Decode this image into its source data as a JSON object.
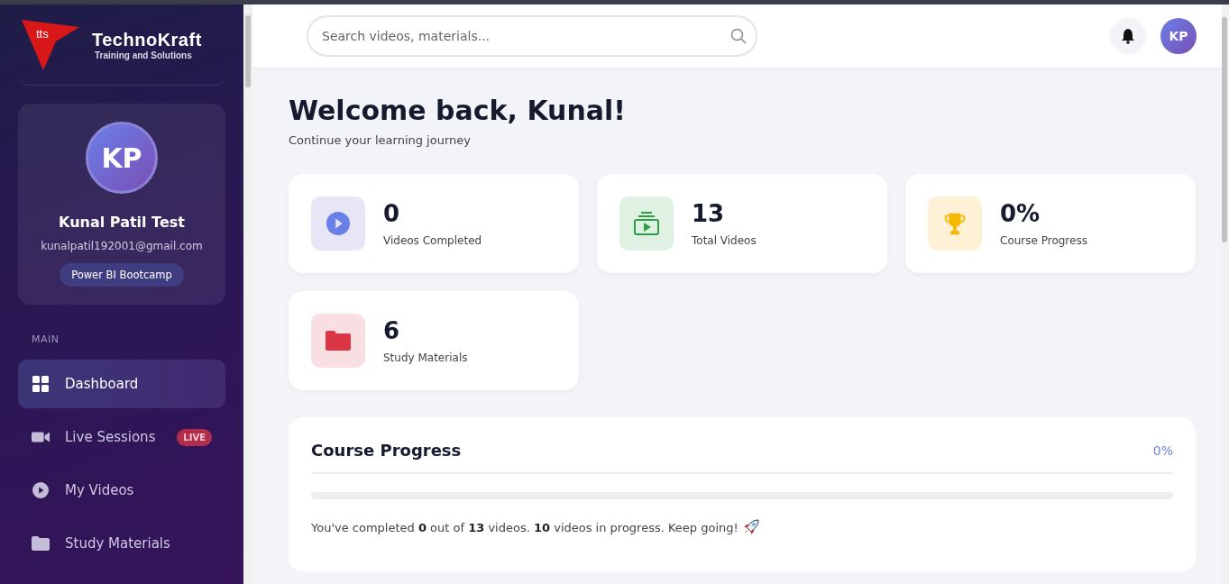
{
  "brand": {
    "mark": "tts",
    "name": "TechnoKraft",
    "tagline": "Training and Solutions"
  },
  "profile": {
    "initials": "KP",
    "name": "Kunal Patil Test",
    "email": "kunalpatil192001@gmail.com",
    "course": "Power BI Bootcamp"
  },
  "nav": {
    "section": "MAIN",
    "items": [
      {
        "label": "Dashboard",
        "kind": "grid",
        "selected": true
      },
      {
        "label": "Live Sessions",
        "kind": "camera",
        "selected": false,
        "badge": "LIVE"
      },
      {
        "label": "My Videos",
        "kind": "play",
        "selected": false
      },
      {
        "label": "Study Materials",
        "kind": "folder",
        "selected": false
      }
    ]
  },
  "header": {
    "search": {
      "placeholder": "Search videos, materials..."
    },
    "avatar": "KP"
  },
  "welcome": {
    "title": "Welcome back, Kunal!",
    "subtitle": "Continue your learning journey"
  },
  "stats": [
    {
      "kind": "play",
      "value": "0",
      "label": "Videos Completed"
    },
    {
      "kind": "videos",
      "value": "13",
      "label": "Total Videos"
    },
    {
      "kind": "trophy",
      "value": "0%",
      "label": "Course Progress"
    },
    {
      "kind": "folder",
      "value": "6",
      "label": "Study Materials"
    }
  ],
  "progress": {
    "title": "Course Progress",
    "percent": "0%",
    "level": 0,
    "message": "You've completed **0** out of **13** videos. **10** videos in progress. Keep going!"
  }
}
